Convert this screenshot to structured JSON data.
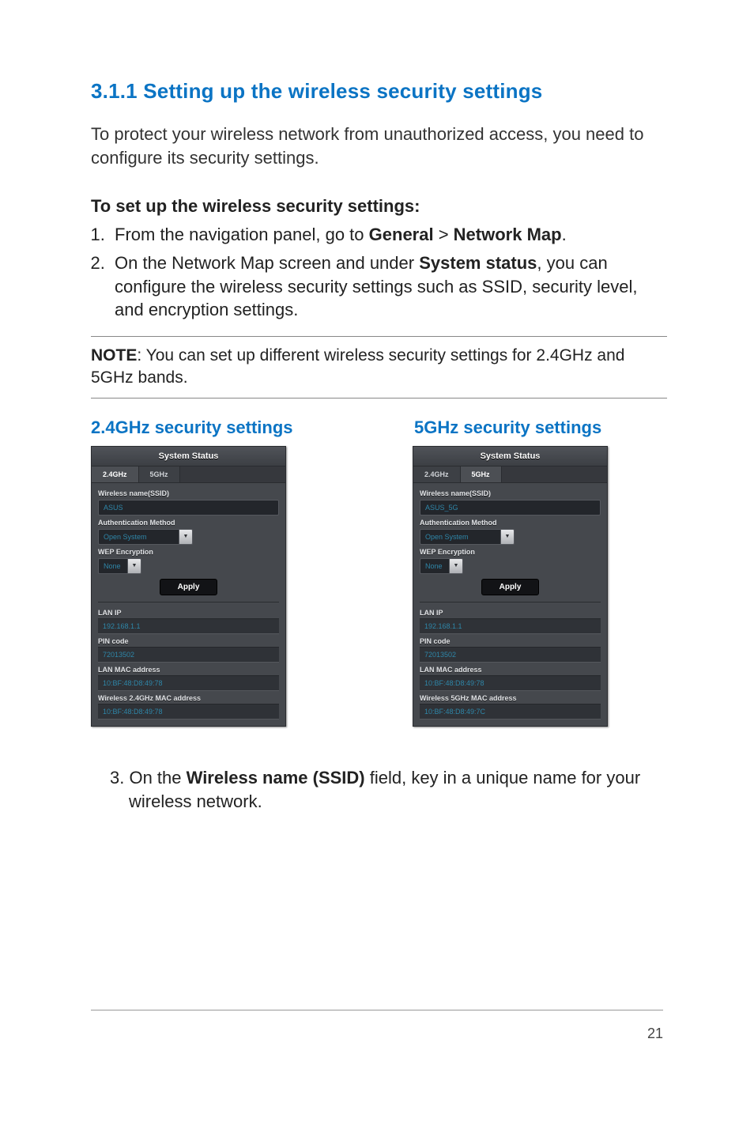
{
  "heading": "3.1.1  Setting up the wireless security settings",
  "intro": "To protect your wireless network from unauthorized access, you need to configure its security settings.",
  "subhead": "To set up the wireless security settings:",
  "steps": {
    "s1_pre": "From the navigation panel, go to ",
    "s1_b1": "General",
    "s1_mid": " > ",
    "s1_b2": "Network Map",
    "s1_post": ".",
    "s2_pre": "On the Network Map screen and under ",
    "s2_b1": "System status",
    "s2_post": ", you can configure the wireless security settings such as SSID, security level, and encryption settings."
  },
  "note_label": "NOTE",
  "note_text": ": You can set up different wireless security settings for 2.4GHz and 5GHz bands.",
  "col_left_title": "2.4GHz security settings",
  "col_right_title": "5GHz security settings",
  "panel_header": "System Status",
  "tabs": {
    "t1": "2.4GHz",
    "t2": "5GHz"
  },
  "labels": {
    "ssid": "Wireless name(SSID)",
    "auth": "Authentication Method",
    "wep": "WEP Encryption",
    "apply": "Apply",
    "lanip": "LAN IP",
    "pin": "PIN code",
    "lanmac": "LAN MAC address",
    "wmac24": "Wireless 2.4GHz MAC address",
    "wmac5": "Wireless 5GHz MAC address"
  },
  "values": {
    "ssid_24": "ASUS",
    "ssid_5": "ASUS_5G",
    "auth": "Open System",
    "wep": "None",
    "lanip": "192.168.1.1",
    "pin": "72013502",
    "lanmac": "10:BF:48:D8:49:78",
    "wmac24": "10:BF:48:D8:49:78",
    "wmac5": "10:BF:48:D8:49:7C"
  },
  "step3_pre": "3.  On the ",
  "step3_b": "Wireless name (SSID)",
  "step3_post": " field, key in a unique name for your wireless network.",
  "page_number": "21"
}
